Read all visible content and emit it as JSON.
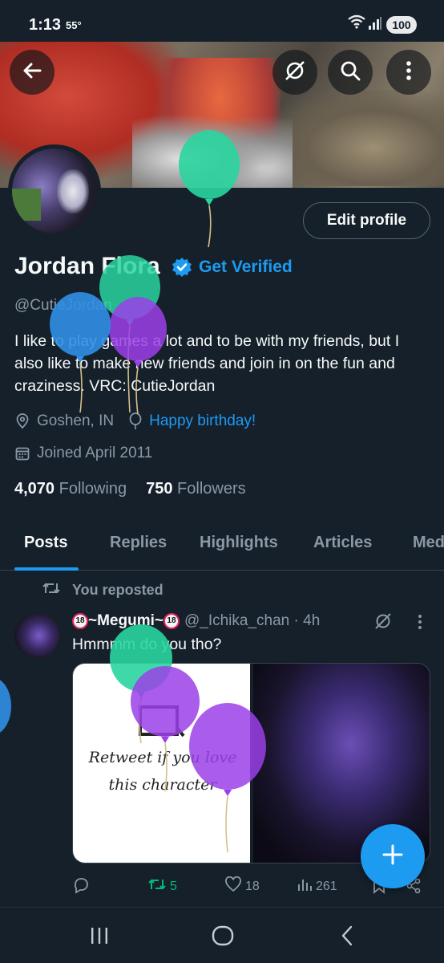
{
  "status_bar": {
    "time": "1:13",
    "temperature": "55°",
    "battery": "100"
  },
  "header": {
    "back_icon": "arrow-left-icon",
    "search_icon": "search-icon",
    "more_icon": "more-vertical-icon"
  },
  "profile": {
    "edit_label": "Edit profile",
    "display_name": "Jordan Flora",
    "get_verified": "Get Verified",
    "handle": "@CutieJordan",
    "bio": "I like to play games a lot and to be with my friends, but I also like to make new friends and join in on the fun and craziness.   VRC: CutieJordan",
    "location": "Goshen, IN",
    "birthday": "Happy birthday!",
    "joined": "Joined April 2011",
    "following_count": "4,070",
    "following_label": "Following",
    "followers_count": "750",
    "followers_label": "Followers"
  },
  "tabs": [
    {
      "label": "Posts"
    },
    {
      "label": "Replies"
    },
    {
      "label": "Highlights"
    },
    {
      "label": "Articles"
    },
    {
      "label": "Med"
    }
  ],
  "post": {
    "repost_label": "You reposted",
    "display_name": "~Megumi~",
    "nsfw_badge": "18",
    "handle_time": "@_Ichika_chan · 4h",
    "text": "Hmmmm do you tho?",
    "meme_text": "Retweet if you love this character",
    "retweets": "5",
    "likes": "18",
    "views": "261"
  },
  "colors": {
    "accent": "#1d9bf0",
    "background": "#15202b",
    "muted": "#8b98a5",
    "retweet_green": "#00ba7c"
  }
}
